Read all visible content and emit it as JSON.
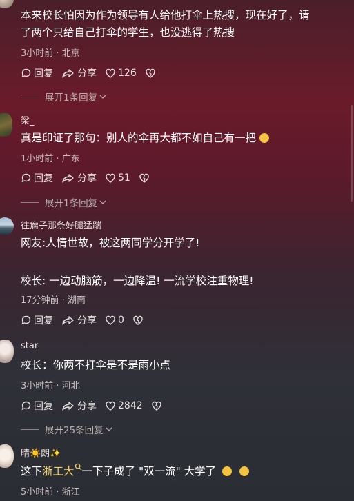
{
  "comments": [
    {
      "username": "",
      "text_line1": "本来校长怕因为作为领导有人给他打伞上热搜，现在好了，请",
      "text_line2": "了两个只给自己打伞的学生，也没逃得了热搜",
      "meta": "3小时前 · 北京",
      "reply": "回复",
      "share": "分享",
      "likes": "126",
      "expand": "展开1条回复"
    },
    {
      "username": "梁_",
      "text_line1": "真是印证了那句：别人的伞再大都不如自己有一把",
      "meta": "1小时前 · 广东",
      "reply": "回复",
      "share": "分享",
      "likes": "51",
      "expand": "展开1条回复"
    },
    {
      "username": "往瘸子那条好腿猛踹",
      "text_line1": "网友:人情世故，被这两同学分开学了!",
      "text_line2": "校长: 一边动脑筋，一边降温! 一流学校注重物理!",
      "meta": "17分钟前 · 湖南",
      "reply": "回复",
      "share": "分享",
      "likes": "0"
    },
    {
      "username": "star",
      "text_line1": "校长：你两不打伞是不是雨小点",
      "meta": "3小时前 · 河北",
      "reply": "回复",
      "share": "分享",
      "likes": "2842",
      "expand": "展开25条回复"
    },
    {
      "username": "晴☀️朗✨",
      "text_prefix": "这下",
      "text_link": "浙工大",
      "text_suffix": "一下子成了 \"双一流\" 大学了",
      "meta": "5小时前 · 浙江"
    }
  ],
  "icons": {
    "reply": "comment-bubble-icon",
    "share": "share-arrow-icon",
    "like": "heart-icon",
    "dislike": "broken-heart-icon",
    "search": "search-icon",
    "chevron": "chevron-down-icon"
  },
  "colors": {
    "highlight": "#f3d06a"
  }
}
